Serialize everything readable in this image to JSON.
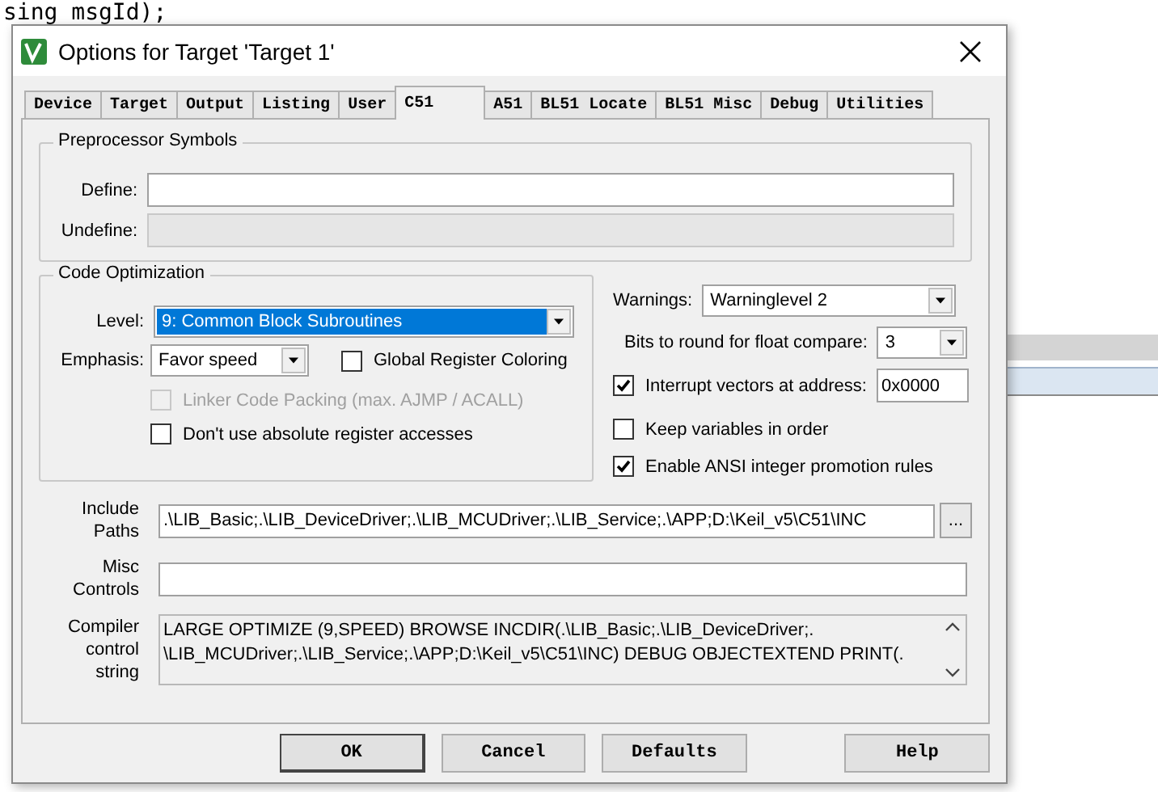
{
  "background_code": {
    "lines": [
      "sing msgId);"
    ]
  },
  "window": {
    "title": "Options for Target 'Target 1'"
  },
  "tabs": [
    {
      "label": "Device",
      "selected": false
    },
    {
      "label": "Target",
      "selected": false
    },
    {
      "label": "Output",
      "selected": false
    },
    {
      "label": "Listing",
      "selected": false
    },
    {
      "label": "User",
      "selected": false
    },
    {
      "label": "C51",
      "selected": true
    },
    {
      "label": "A51",
      "selected": false
    },
    {
      "label": "BL51 Locate",
      "selected": false
    },
    {
      "label": "BL51 Misc",
      "selected": false
    },
    {
      "label": "Debug",
      "selected": false
    },
    {
      "label": "Utilities",
      "selected": false
    }
  ],
  "preprocessor": {
    "title": "Preprocessor Symbols",
    "fields": [
      {
        "label": "Define:",
        "disabled": false
      },
      {
        "label": "Undefine:",
        "disabled": true
      }
    ]
  },
  "code_optimization": {
    "title": "Code Optimization",
    "level": {
      "label": "Level:",
      "value": "9: Common Block Subroutines"
    },
    "emphasis": {
      "label": "Emphasis:",
      "value": "Favor speed"
    },
    "global_register_coloring": {
      "label": "Global Register Coloring",
      "checked": false,
      "disabled": false
    },
    "options": [
      {
        "label": "Linker Code Packing (max. AJMP / ACALL)",
        "checked": false,
        "disabled": true
      },
      {
        "label": "Don't use absolute register accesses",
        "checked": false,
        "disabled": false
      }
    ]
  },
  "warnings": {
    "label": "Warnings:",
    "value": "Warninglevel 2"
  },
  "float_bits": {
    "label": "Bits to round for float compare:",
    "value": "3"
  },
  "interrupt_vectors": {
    "label": "Interrupt vectors at address:",
    "checked": true,
    "value": "0x0000"
  },
  "right_options": [
    {
      "label": "Keep variables in order",
      "checked": false
    },
    {
      "label": "Enable ANSI integer promotion rules",
      "checked": true
    }
  ],
  "include_paths": {
    "label": "Include Paths",
    "value": ".\\LIB_Basic;.\\LIB_DeviceDriver;.\\LIB_MCUDriver;.\\LIB_Service;.\\APP;D:\\Keil_v5\\C51\\INC",
    "browse": "..."
  },
  "misc_controls": {
    "label": "Misc Controls"
  },
  "compiler_control": {
    "label": "Compiler control string",
    "lines": [
      "LARGE OPTIMIZE (9,SPEED) BROWSE INCDIR(.\\LIB_Basic;.\\LIB_DeviceDriver;.",
      "\\LIB_MCUDriver;.\\LIB_Service;.\\APP;D:\\Keil_v5\\C51\\INC) DEBUG OBJECTEXTEND PRINT(."
    ]
  },
  "buttons": [
    {
      "label": "OK",
      "default": true
    },
    {
      "label": "Cancel",
      "default": false
    },
    {
      "label": "Defaults",
      "default": false
    },
    {
      "label": "Help",
      "default": false
    }
  ]
}
